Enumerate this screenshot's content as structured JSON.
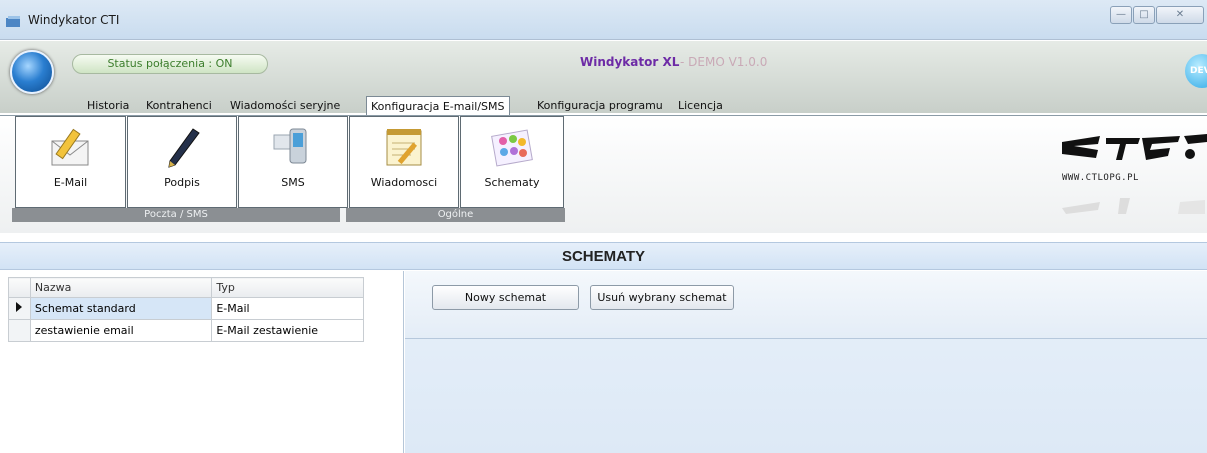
{
  "window": {
    "title": "Windykator CTI"
  },
  "header": {
    "status": "Status połączenia : ON",
    "product": "Windykator XL",
    "product_suffix": "- DEMO V1.0.0",
    "badge": "DEV"
  },
  "tabs": [
    {
      "label": "Historia"
    },
    {
      "label": "Kontrahenci"
    },
    {
      "label": "Wiadomości seryjne"
    },
    {
      "label": "Konfiguracja E-mail/SMS",
      "active": true
    },
    {
      "label": "Konfiguracja programu"
    },
    {
      "label": "Licencja"
    }
  ],
  "ribbon": {
    "buttons": [
      {
        "label": "E-Mail",
        "icon": "email-icon"
      },
      {
        "label": "Podpis",
        "icon": "pen-icon"
      },
      {
        "label": "SMS",
        "icon": "phone-icon"
      },
      {
        "label": "Wiadomosci",
        "icon": "notepad-icon"
      },
      {
        "label": "Schematy",
        "icon": "palette-icon"
      }
    ],
    "groups": [
      {
        "label": "Poczta / SMS"
      },
      {
        "label": "Ogólne"
      }
    ],
    "logo_text": "WWW.CTLOPG.PL"
  },
  "section": {
    "title": "SCHEMATY"
  },
  "grid": {
    "columns": [
      "Nazwa",
      "Typ"
    ],
    "rows": [
      {
        "name": "Schemat standard",
        "type": "E-Mail",
        "selected": true
      },
      {
        "name": "zestawienie email",
        "type": "E-Mail zestawienie"
      }
    ]
  },
  "actions": {
    "new": "Nowy schemat",
    "delete": "Usuń wybrany schemat"
  }
}
